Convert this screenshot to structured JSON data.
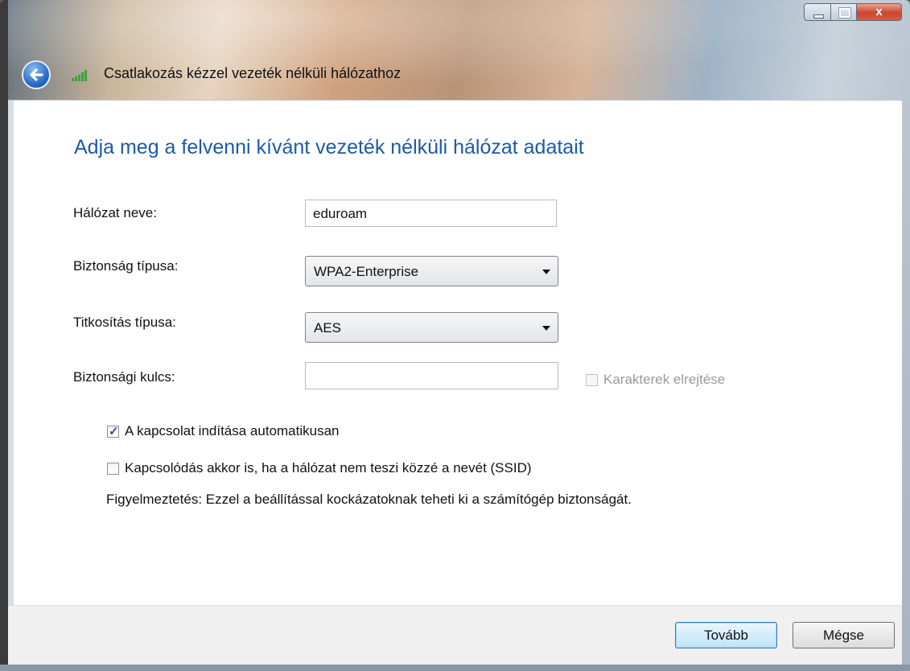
{
  "window": {
    "title": "Csatlakozás kézzel vezeték nélküli hálózathoz",
    "close_label": "x"
  },
  "main": {
    "heading": "Adja meg a felvenni kívánt vezeték nélküli hálózat adatait",
    "network_name": {
      "label": "Hálózat neve:",
      "value": "eduroam"
    },
    "security_type": {
      "label": "Biztonság típusa:",
      "value": "WPA2-Enterprise"
    },
    "encryption_type": {
      "label": "Titkosítás típusa:",
      "value": "AES"
    },
    "security_key": {
      "label": "Biztonsági kulcs:",
      "value": "",
      "hide_chars_label": "Karakterek elrejtése"
    },
    "auto_start": {
      "label": "A kapcsolat indítása automatikusan",
      "checked": true
    },
    "hidden_ssid": {
      "label": "Kapcsolódás akkor is, ha a hálózat nem teszi közzé a nevét (SSID)",
      "checked": false
    },
    "warning": "Figyelmeztetés: Ezzel a beállítással kockázatoknak teheti ki a számítógép biztonságát."
  },
  "footer": {
    "next_label": "Tovább",
    "cancel_label": "Mégse"
  },
  "colors": {
    "heading": "#1e5aa8",
    "close_button": "#c9452d"
  }
}
